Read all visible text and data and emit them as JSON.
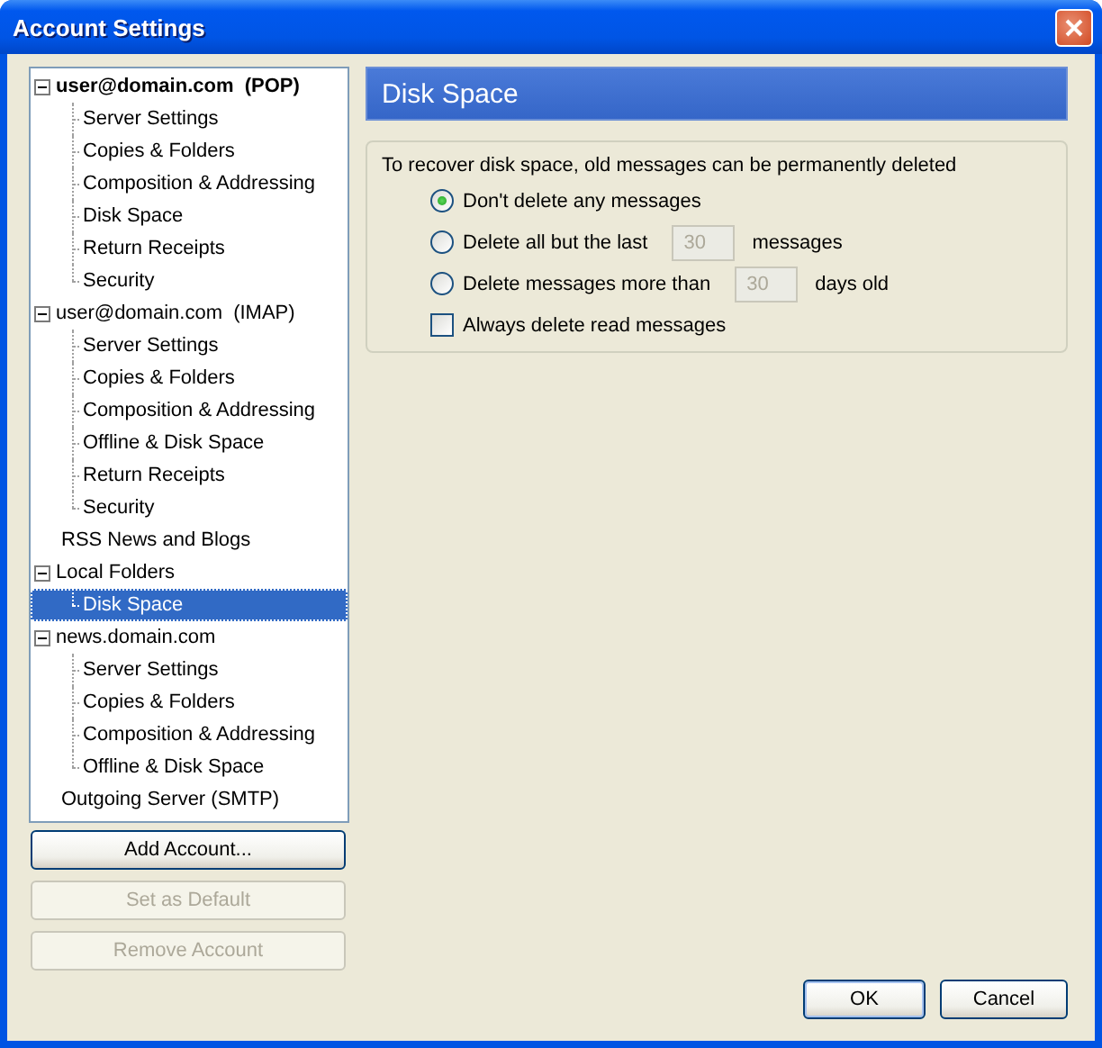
{
  "window": {
    "title": "Account Settings"
  },
  "tree": [
    {
      "label": "user@domain.com  (POP)",
      "default": true,
      "expanded": true,
      "selected": false,
      "children": [
        {
          "label": "Server Settings",
          "selected": false
        },
        {
          "label": "Copies & Folders",
          "selected": false
        },
        {
          "label": "Composition & Addressing",
          "selected": false
        },
        {
          "label": "Disk Space",
          "selected": false
        },
        {
          "label": "Return Receipts",
          "selected": false
        },
        {
          "label": "Security",
          "selected": false
        }
      ]
    },
    {
      "label": "user@domain.com  (IMAP)",
      "default": false,
      "expanded": true,
      "selected": false,
      "children": [
        {
          "label": "Server Settings",
          "selected": false
        },
        {
          "label": "Copies & Folders",
          "selected": false
        },
        {
          "label": "Composition & Addressing",
          "selected": false
        },
        {
          "label": "Offline & Disk Space",
          "selected": false
        },
        {
          "label": "Return Receipts",
          "selected": false
        },
        {
          "label": "Security",
          "selected": false
        }
      ]
    },
    {
      "label": "RSS News and Blogs",
      "default": false,
      "selected": false
    },
    {
      "label": "Local Folders",
      "default": false,
      "expanded": true,
      "selected": false,
      "children": [
        {
          "label": "Disk Space",
          "selected": true
        }
      ]
    },
    {
      "label": "news.domain.com",
      "default": false,
      "expanded": true,
      "selected": false,
      "children": [
        {
          "label": "Server Settings",
          "selected": false
        },
        {
          "label": "Copies & Folders",
          "selected": false
        },
        {
          "label": "Composition & Addressing",
          "selected": false
        },
        {
          "label": "Offline & Disk Space",
          "selected": false
        }
      ]
    },
    {
      "label": "Outgoing Server (SMTP)",
      "default": false,
      "selected": false
    }
  ],
  "account_buttons": [
    {
      "label": "Add Account...",
      "disabled": false
    },
    {
      "label": "Set as Default",
      "disabled": true
    },
    {
      "label": "Remove Account",
      "disabled": true
    }
  ],
  "panel": {
    "title": "Disk Space",
    "description": "To recover disk space, old messages can be permanently deleted",
    "options": [
      {
        "kind": "radio",
        "label": "Don't delete any messages",
        "selected": true
      },
      {
        "kind": "radio",
        "label": "Delete all but the last",
        "selected": false,
        "field": {
          "value": "30",
          "disabled": true
        },
        "suffix": "messages"
      },
      {
        "kind": "radio",
        "label": "Delete messages more than",
        "selected": false,
        "field": {
          "value": "30",
          "disabled": true
        },
        "suffix": "days old"
      },
      {
        "kind": "checkbox",
        "label": "Always delete read messages",
        "checked": false
      }
    ]
  },
  "dialog_buttons": [
    "OK",
    "Cancel"
  ]
}
